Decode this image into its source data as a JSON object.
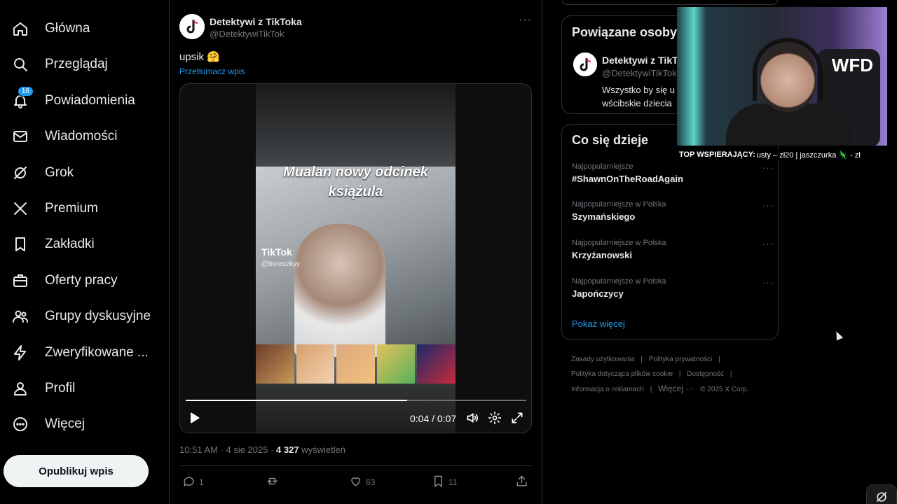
{
  "nav": {
    "items": [
      {
        "label": "Główna",
        "icon": "home-icon"
      },
      {
        "label": "Przeglądaj",
        "icon": "search-icon"
      },
      {
        "label": "Powiadomienia",
        "icon": "bell-icon",
        "badge": "16"
      },
      {
        "label": "Wiadomości",
        "icon": "mail-icon"
      },
      {
        "label": "Grok",
        "icon": "grok-icon"
      },
      {
        "label": "Premium",
        "icon": "x-logo-icon"
      },
      {
        "label": "Zakładki",
        "icon": "bookmark-icon"
      },
      {
        "label": "Oferty pracy",
        "icon": "briefcase-icon"
      },
      {
        "label": "Grupy dyskusyjne",
        "icon": "people-icon"
      },
      {
        "label": "Zweryfikowane ...",
        "icon": "lightning-icon"
      },
      {
        "label": "Profil",
        "icon": "person-icon"
      },
      {
        "label": "Więcej",
        "icon": "more-circle-icon"
      }
    ],
    "publish_label": "Opublikuj wpis"
  },
  "post": {
    "author_name": "Detektywi z TikToka",
    "author_handle": "@DetektywiTikTok",
    "more": "···",
    "text": "upsik 🤗",
    "translate_label": "Przetłumacz wpis",
    "video": {
      "caption_line1": "Mualan nowy odcinek",
      "caption_line2": "książula",
      "tiktok_label": "TikTok",
      "tiktok_handle": "@boreczkyy",
      "time": "0:04 / 0:07",
      "progress": 0.65
    },
    "timestamp": "10:51 AM · 4 sie 2025 · ",
    "views_count": "4 327",
    "views_label": " wyświetleń",
    "actions": {
      "replies": "1",
      "reposts": "",
      "likes": "63",
      "bookmarks": "11"
    }
  },
  "related": {
    "title": "Powiązane osoby",
    "name": "Detektywi z TikT...",
    "handle": "@DetektywiTikTok",
    "bio_line1": "Wszystko by się u",
    "bio_line2": "wścibskie dziecia"
  },
  "trends": {
    "title": "Co się dzieje",
    "items": [
      {
        "context": "Najpopularniejsze",
        "name": "#ShawnOnTheRoadAgain"
      },
      {
        "context": "Najpopularniejsze w Polska",
        "name": "Szymańskiego"
      },
      {
        "context": "Najpopularniejsze w Polska",
        "name": "Krzyżanowski"
      },
      {
        "context": "Najpopularniejsze w Polska",
        "name": "Japończycy"
      }
    ],
    "dots": "···",
    "show_more": "Pokaż więcej"
  },
  "footer": {
    "links": [
      "Zasady użytkowania",
      "Polityka prywatności",
      "Polityka dotycząca plików cookie",
      "Dostępność",
      "Informacja o reklamach",
      "Więcej ···"
    ],
    "copyright": "© 2025 X Corp."
  },
  "overlay": {
    "cam_logo": "WFD",
    "ticker_label": "TOP WSPIERAJĄCY:",
    "ticker_text": " usty – zł20 |    jaszczurka 🦎 - zł"
  }
}
